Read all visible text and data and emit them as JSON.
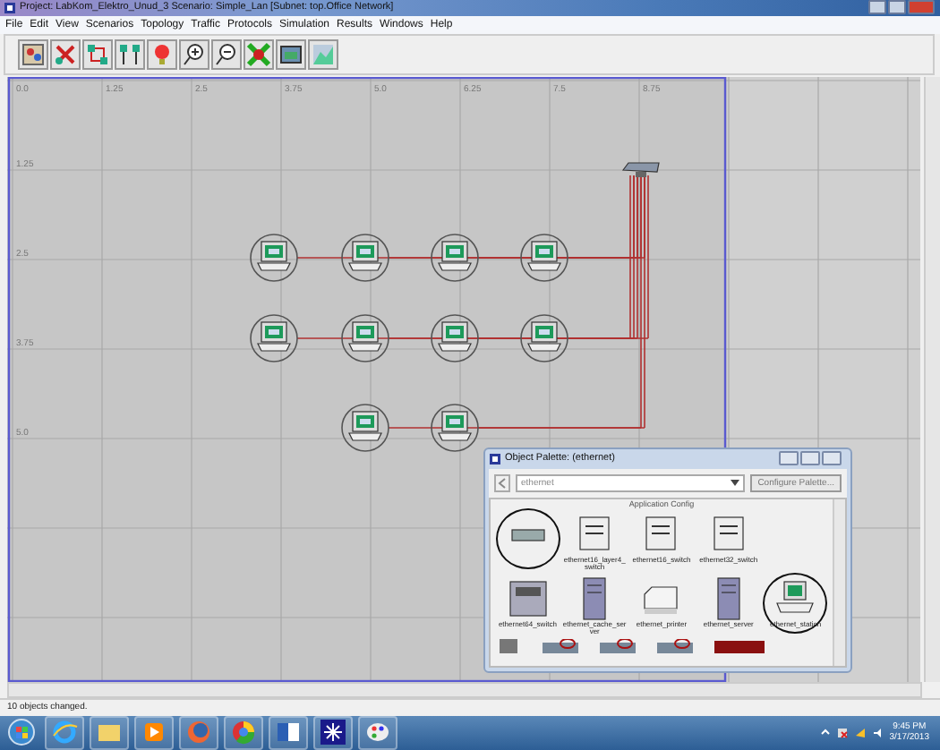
{
  "window": {
    "title": "Project: LabKom_Elektro_Unud_3 Scenario: Simple_Lan  [Subnet: top.Office Network]"
  },
  "menu": [
    "File",
    "Edit",
    "View",
    "Scenarios",
    "Topology",
    "Traffic",
    "Protocols",
    "Simulation",
    "Results",
    "Windows",
    "Help"
  ],
  "canvas": {
    "x_ticks": [
      "0.0",
      "1.25",
      "2.5",
      "3.75",
      "5.0",
      "6.25",
      "7.5",
      "8.75"
    ],
    "y_ticks": [
      "1.25",
      "2.5",
      "3.75",
      "5.0"
    ],
    "nodes": [
      {
        "kind": "switch"
      },
      {
        "kind": "workstation"
      },
      {
        "kind": "workstation"
      },
      {
        "kind": "workstation"
      },
      {
        "kind": "workstation"
      },
      {
        "kind": "workstation"
      },
      {
        "kind": "workstation"
      },
      {
        "kind": "workstation"
      },
      {
        "kind": "workstation"
      },
      {
        "kind": "workstation"
      },
      {
        "kind": "workstation"
      }
    ]
  },
  "palette": {
    "title": "Object Palette: (ethernet)",
    "search": {
      "value": "ethernet"
    },
    "button": "Configure Palette...",
    "caption": "Application Config",
    "items": [
      {
        "kind": "hub",
        "circled": true
      },
      {
        "kind": "switch",
        "label": "ethernet16_layer4_switch",
        "circled": false
      },
      {
        "kind": "switch",
        "label": "ethernet16_switch",
        "circled": false
      },
      {
        "kind": "switch",
        "label": "ethernet32_switch",
        "circled": false
      },
      {
        "kind": "empty",
        "circled": false
      },
      {
        "kind": "rack",
        "label": "ethernet64_switch",
        "circled": false
      },
      {
        "kind": "server",
        "label": "ethernet_cache_server",
        "circled": false
      },
      {
        "kind": "printer",
        "label": "ethernet_printer",
        "circled": false
      },
      {
        "kind": "server",
        "label": "ethernet_server",
        "circled": false
      },
      {
        "kind": "workstation",
        "label": "ethernet_station",
        "circled": true
      }
    ]
  },
  "status_bar": "10 objects changed.",
  "taskbar": {
    "time": "9:45 PM",
    "date": "3/17/2013"
  }
}
